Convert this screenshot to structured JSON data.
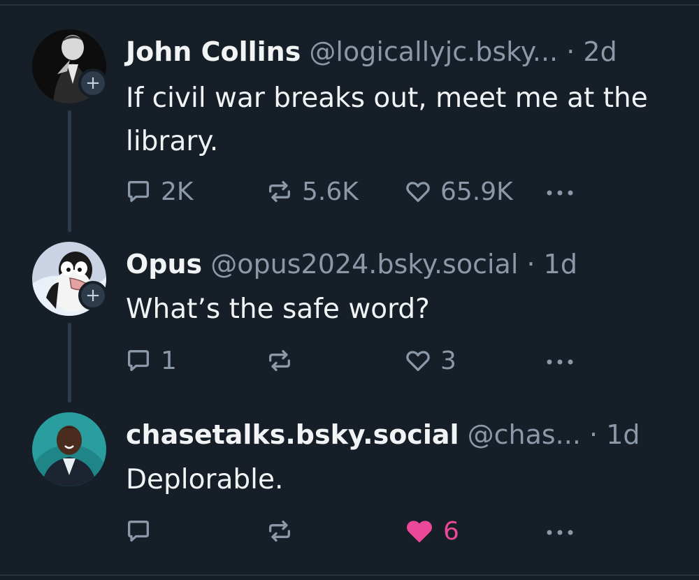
{
  "posts": [
    {
      "name": "John Collins",
      "handle": "@logicallyjc.bsky...",
      "dot": "·",
      "time": "2d",
      "text": "If civil war breaks out, meet me at the library.",
      "reply_count": "2K",
      "repost_count": "5.6K",
      "like_count": "65.9K",
      "liked": false,
      "follow_badge": "+"
    },
    {
      "name": "Opus",
      "handle": "@opus2024.bsky.social",
      "dot": "·",
      "time": "1d",
      "text": "What’s the safe word?",
      "reply_count": "1",
      "repost_count": "",
      "like_count": "3",
      "liked": false,
      "follow_badge": "+"
    },
    {
      "name": "chasetalks.bsky.social",
      "handle": "@chas...",
      "dot": "·",
      "time": "1d",
      "text": "Deplorable.",
      "reply_count": "",
      "repost_count": "",
      "like_count": "6",
      "liked": true
    }
  ],
  "icons": {
    "reply": "reply-icon",
    "repost": "repost-icon",
    "like": "heart-icon",
    "more": "more-options-icon"
  },
  "colors": {
    "background": "#161e27",
    "text": "#f1f3f5",
    "muted": "#8b98a7",
    "like_active": "#ec4899",
    "thread_line": "#2e3b4a"
  }
}
